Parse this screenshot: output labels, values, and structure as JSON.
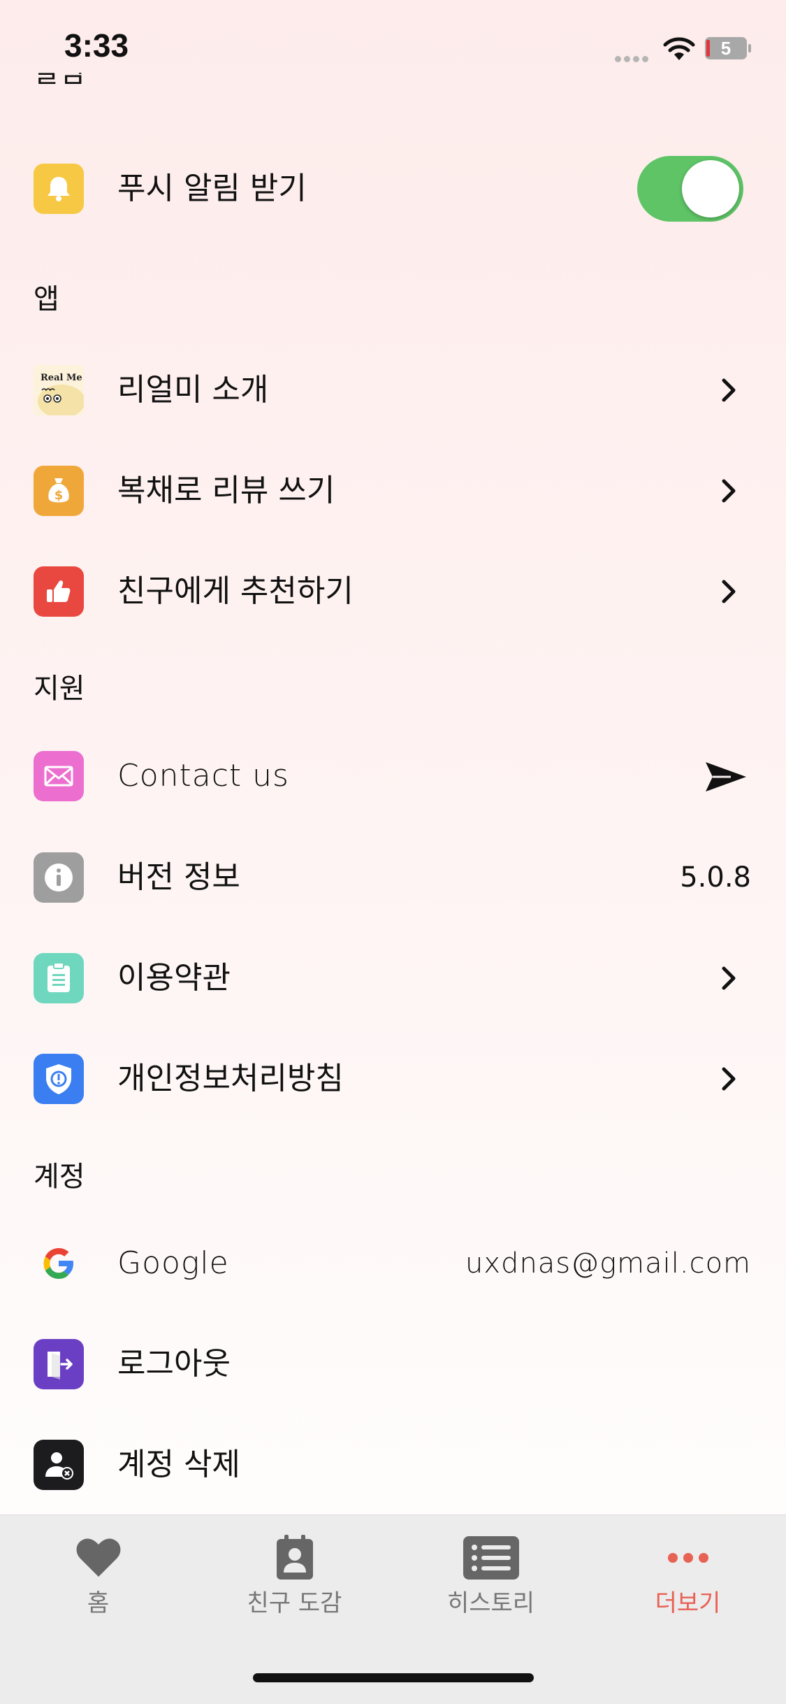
{
  "status_bar": {
    "time": "3:33",
    "battery": "5"
  },
  "partial_header": "알림",
  "notifications": {
    "push_label": "푸시 알림 받기",
    "push_enabled": true
  },
  "sections": {
    "app": "앱",
    "support": "지원",
    "account": "계정"
  },
  "app_items": {
    "intro": "리얼미 소개",
    "intro_logo": "Real Me",
    "review": "복채로 리뷰 쓰기",
    "recommend": "친구에게 추천하기"
  },
  "support_items": {
    "contact": "Contact us",
    "version_label": "버전 정보",
    "version_value": "5.0.8",
    "terms": "이용약관",
    "privacy": "개인정보처리방침"
  },
  "account_items": {
    "google_label": "Google",
    "google_email": "uxdnas@gmail.com",
    "logout": "로그아웃",
    "delete": "계정 삭제"
  },
  "tabs": [
    {
      "label": "홈",
      "icon": "heart-icon"
    },
    {
      "label": "친구 도감",
      "icon": "contact-book-icon"
    },
    {
      "label": "히스토리",
      "icon": "list-icon"
    },
    {
      "label": "더보기",
      "icon": "more-dots-icon",
      "active": true
    }
  ],
  "colors": {
    "accent": "#e86155",
    "toggle_on": "#5ec466",
    "bell": "#f7c843",
    "money": "#f0a73a",
    "thumb": "#e8483f",
    "mail": "#ec6fd0",
    "info": "#9e9e9e",
    "terms": "#6fd7be",
    "privacy": "#3b7ef1",
    "logout": "#6b3fc4",
    "delete": "#1c1c1e"
  }
}
